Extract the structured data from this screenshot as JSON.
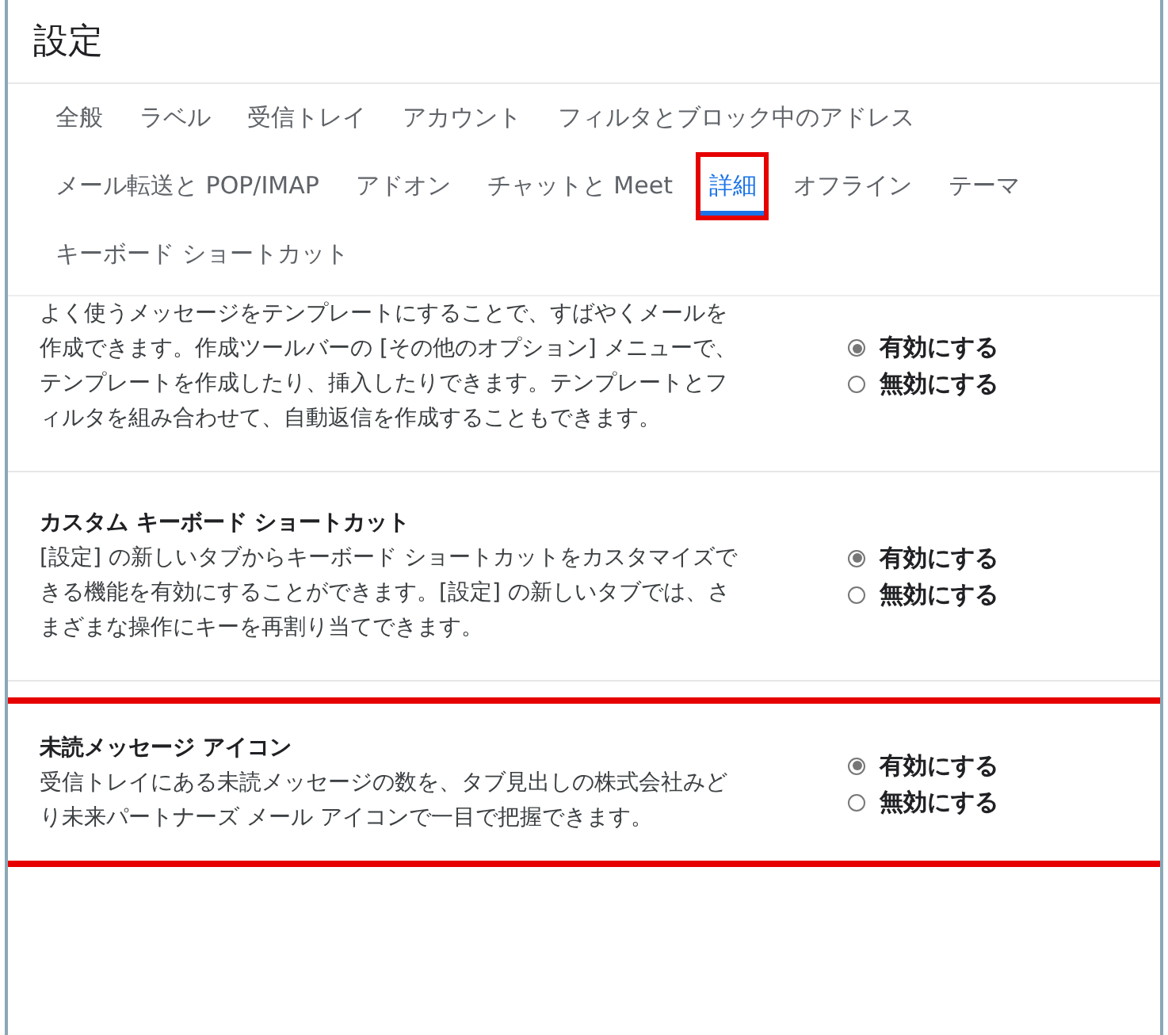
{
  "window": {
    "title": "設定"
  },
  "tabs": [
    {
      "label": "全般",
      "selected": false,
      "highlighted": false
    },
    {
      "label": "ラベル",
      "selected": false,
      "highlighted": false
    },
    {
      "label": "受信トレイ",
      "selected": false,
      "highlighted": false
    },
    {
      "label": "アカウント",
      "selected": false,
      "highlighted": false
    },
    {
      "label": "フィルタとブロック中のアドレス",
      "selected": false,
      "highlighted": false
    },
    {
      "label": "メール転送と POP/IMAP",
      "selected": false,
      "highlighted": false
    },
    {
      "label": "アドオン",
      "selected": false,
      "highlighted": false
    },
    {
      "label": "チャットと Meet",
      "selected": false,
      "highlighted": false
    },
    {
      "label": "詳細",
      "selected": true,
      "highlighted": true
    },
    {
      "label": "オフライン",
      "selected": false,
      "highlighted": false
    },
    {
      "label": "テーマ",
      "selected": false,
      "highlighted": false
    },
    {
      "label": "キーボード ショートカット",
      "selected": false,
      "highlighted": false
    }
  ],
  "sections": [
    {
      "description": "よく使うメッセージをテンプレートにすることで、すばやくメールを作成できます。作成ツールバーの [その他のオプション] メニューで、テンプレートを作成したり、挿入したりできます。テンプレートとフィルタを組み合わせて、自動返信を作成することもできます。",
      "highlighted": false,
      "options": [
        {
          "label": "有効にする",
          "selected": true
        },
        {
          "label": "無効にする",
          "selected": false
        }
      ]
    },
    {
      "title": "カスタム キーボード ショートカット",
      "description": "[設定] の新しいタブからキーボード ショートカットをカスタマイズできる機能を有効にすることができます。[設定] の新しいタブでは、さまざまな操作にキーを再割り当てできます。",
      "highlighted": false,
      "options": [
        {
          "label": "有効にする",
          "selected": true
        },
        {
          "label": "無効にする",
          "selected": false
        }
      ]
    },
    {
      "title": "未読メッセージ アイコン",
      "description": "受信トレイにある未読メッセージの数を、タブ見出しの株式会社みどり未来パートナーズ メール アイコンで一目で把握できます。",
      "highlighted": true,
      "options": [
        {
          "label": "有効にする",
          "selected": true
        },
        {
          "label": "無効にする",
          "selected": false
        }
      ]
    }
  ]
}
